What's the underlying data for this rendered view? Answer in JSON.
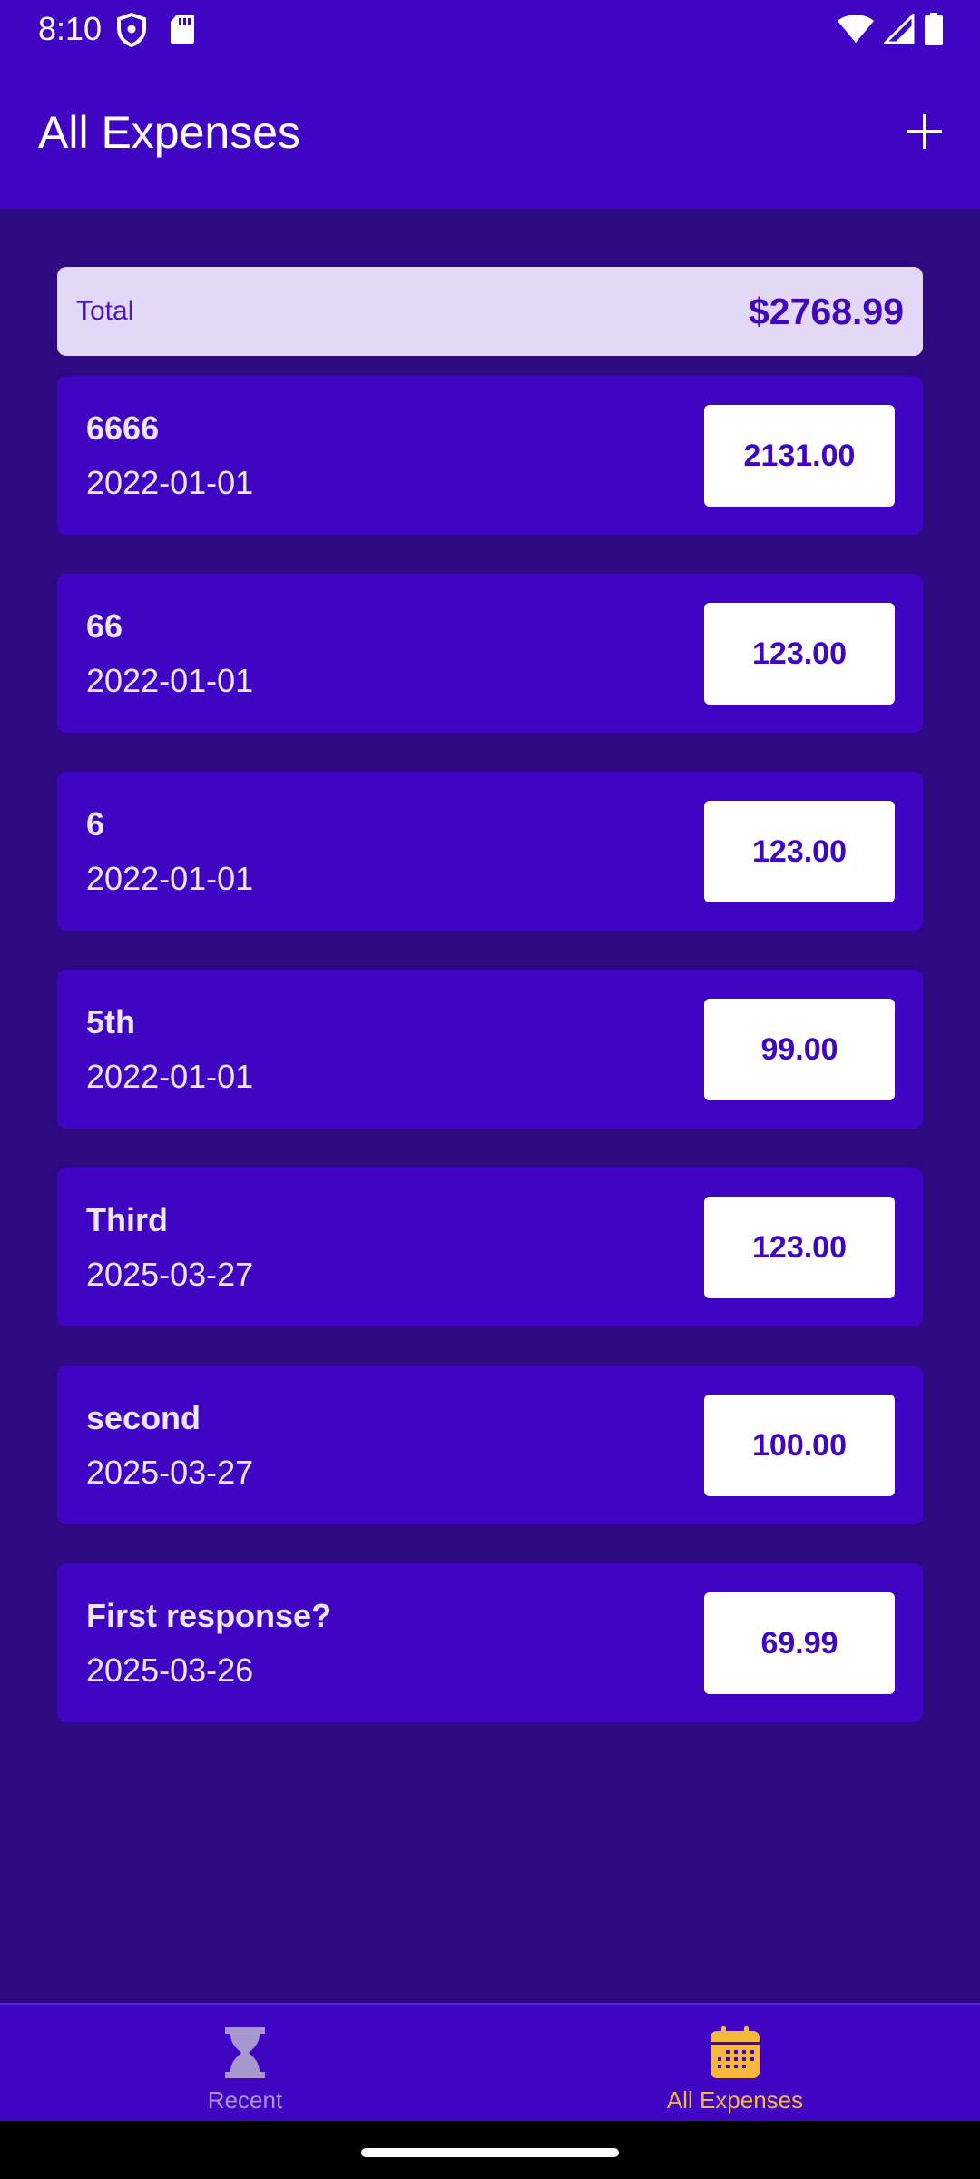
{
  "status_bar": {
    "time": "8:10",
    "icons": [
      "shield-icon",
      "sd-card-icon",
      "wifi-icon",
      "signal-icon",
      "battery-icon"
    ]
  },
  "app_bar": {
    "title": "All Expenses",
    "add_icon": "plus-icon"
  },
  "summary": {
    "label": "Total",
    "value": "$2768.99"
  },
  "expenses": [
    {
      "title": "6666",
      "date": "2022-01-01",
      "amount": "2131.00"
    },
    {
      "title": "66",
      "date": "2022-01-01",
      "amount": "123.00"
    },
    {
      "title": "6",
      "date": "2022-01-01",
      "amount": "123.00"
    },
    {
      "title": "5th",
      "date": "2022-01-01",
      "amount": "99.00"
    },
    {
      "title": "Third",
      "date": "2025-03-27",
      "amount": "123.00"
    },
    {
      "title": "second",
      "date": "2025-03-27",
      "amount": "100.00"
    },
    {
      "title": "First response?",
      "date": "2025-03-26",
      "amount": "69.99"
    }
  ],
  "bottom_nav": {
    "tabs": [
      {
        "label": "Recent",
        "icon": "hourglass-icon",
        "active": false
      },
      {
        "label": "All Expenses",
        "icon": "calendar-icon",
        "active": true
      }
    ]
  },
  "colors": {
    "primary": "#3f05c2",
    "background": "#2e0a82",
    "accent": "#f5b83d",
    "summary_bg": "#e3d9f6",
    "inactive": "#a898d0"
  }
}
